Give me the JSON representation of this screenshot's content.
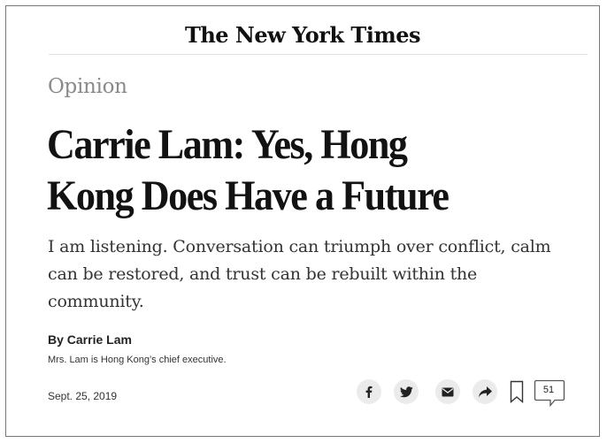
{
  "masthead": {
    "logo_text": "The New York Times"
  },
  "section": {
    "label": "Opinion"
  },
  "article": {
    "headline_line1": "Carrie Lam: Yes, Hong",
    "headline_line2": "Kong Does Have a Future",
    "summary": "I am listening. Conversation can triumph over conflict, calm can be restored, and trust can be rebuilt within the community.",
    "byline": "By Carrie Lam",
    "author_bio": "Mrs. Lam is Hong Kong’s chief executive.",
    "date": "Sept. 25, 2019"
  },
  "share_tools": {
    "icons": [
      "facebook-icon",
      "twitter-icon",
      "email-icon",
      "share-arrow-icon",
      "bookmark-icon",
      "comment-icon"
    ],
    "comment_count": "51"
  },
  "colors": {
    "text": "#121212",
    "section_gray": "#8a8a8a",
    "button_bg": "#ebebeb",
    "frame_border": "#777777"
  }
}
